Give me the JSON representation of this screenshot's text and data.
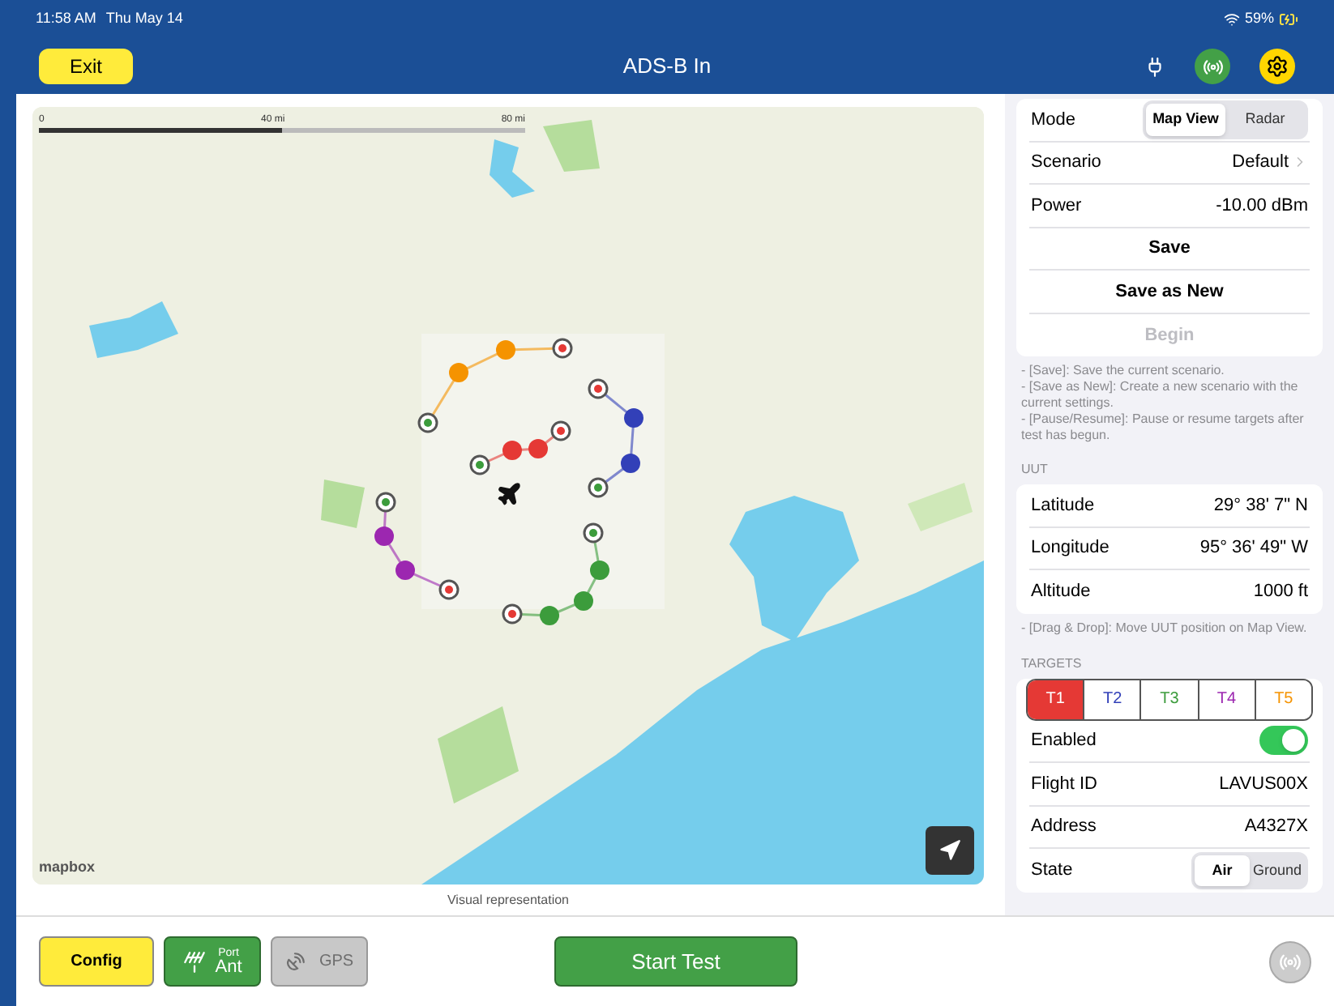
{
  "status_bar": {
    "time": "11:58 AM",
    "date": "Thu May 14",
    "battery": "59%"
  },
  "header": {
    "exit_button": "Exit",
    "title": "ADS-B In"
  },
  "map": {
    "scale_labels": [
      "0",
      "40 mi",
      "80 mi"
    ],
    "attribution": "mapbox",
    "caption": "Visual representation"
  },
  "settings": {
    "mode": {
      "label": "Mode",
      "options": [
        {
          "label": "Map View",
          "selected": true
        },
        {
          "label": "Radar",
          "selected": false
        }
      ]
    },
    "rows": [
      {
        "label": "Scenario",
        "value": "Default",
        "kind": "link"
      },
      {
        "label": "Power",
        "value": "-10.00 dBm",
        "kind": "value"
      }
    ],
    "actions": [
      {
        "label": "Save",
        "disabled": false
      },
      {
        "label": "Save as New",
        "disabled": false
      },
      {
        "label": "Begin",
        "disabled": true
      }
    ],
    "notes": [
      "- [Save]: Save the current scenario.",
      "- [Save as New]: Create a new scenario with the current settings.",
      "- [Pause/Resume]: Pause or resume targets after test has begun."
    ]
  },
  "uut": {
    "heading": "UUT",
    "rows": [
      {
        "label": "Latitude",
        "value": "29° 38' 7\" N"
      },
      {
        "label": "Longitude",
        "value": "95° 36' 49\" W"
      },
      {
        "label": "Altitude",
        "value": "1000 ft"
      }
    ],
    "notes": [
      "- [Drag & Drop]: Move UUT position on Map View."
    ]
  },
  "targets": {
    "heading": "TARGETS",
    "tabs": [
      {
        "label": "T1",
        "color": "#e53935",
        "selected": true
      },
      {
        "label": "T2",
        "color": "#3240b8",
        "selected": false
      },
      {
        "label": "T3",
        "color": "#3c9c3c",
        "selected": false
      },
      {
        "label": "T4",
        "color": "#9c27b0",
        "selected": false
      },
      {
        "label": "T5",
        "color": "#f59300",
        "selected": false
      }
    ],
    "enabled": {
      "label": "Enabled",
      "on": true
    },
    "rows": [
      {
        "label": "Flight ID",
        "value": "LAVUS00X"
      },
      {
        "label": "Address",
        "value": "A4327X"
      }
    ],
    "state": {
      "label": "State",
      "options": [
        {
          "label": "Air",
          "selected": true
        },
        {
          "label": "Ground",
          "selected": false
        }
      ]
    }
  },
  "toolbar": {
    "config": "Config",
    "port": {
      "caption": "Port",
      "label": "Ant"
    },
    "gps": {
      "label": "GPS",
      "disabled": true
    },
    "start": "Start Test"
  }
}
